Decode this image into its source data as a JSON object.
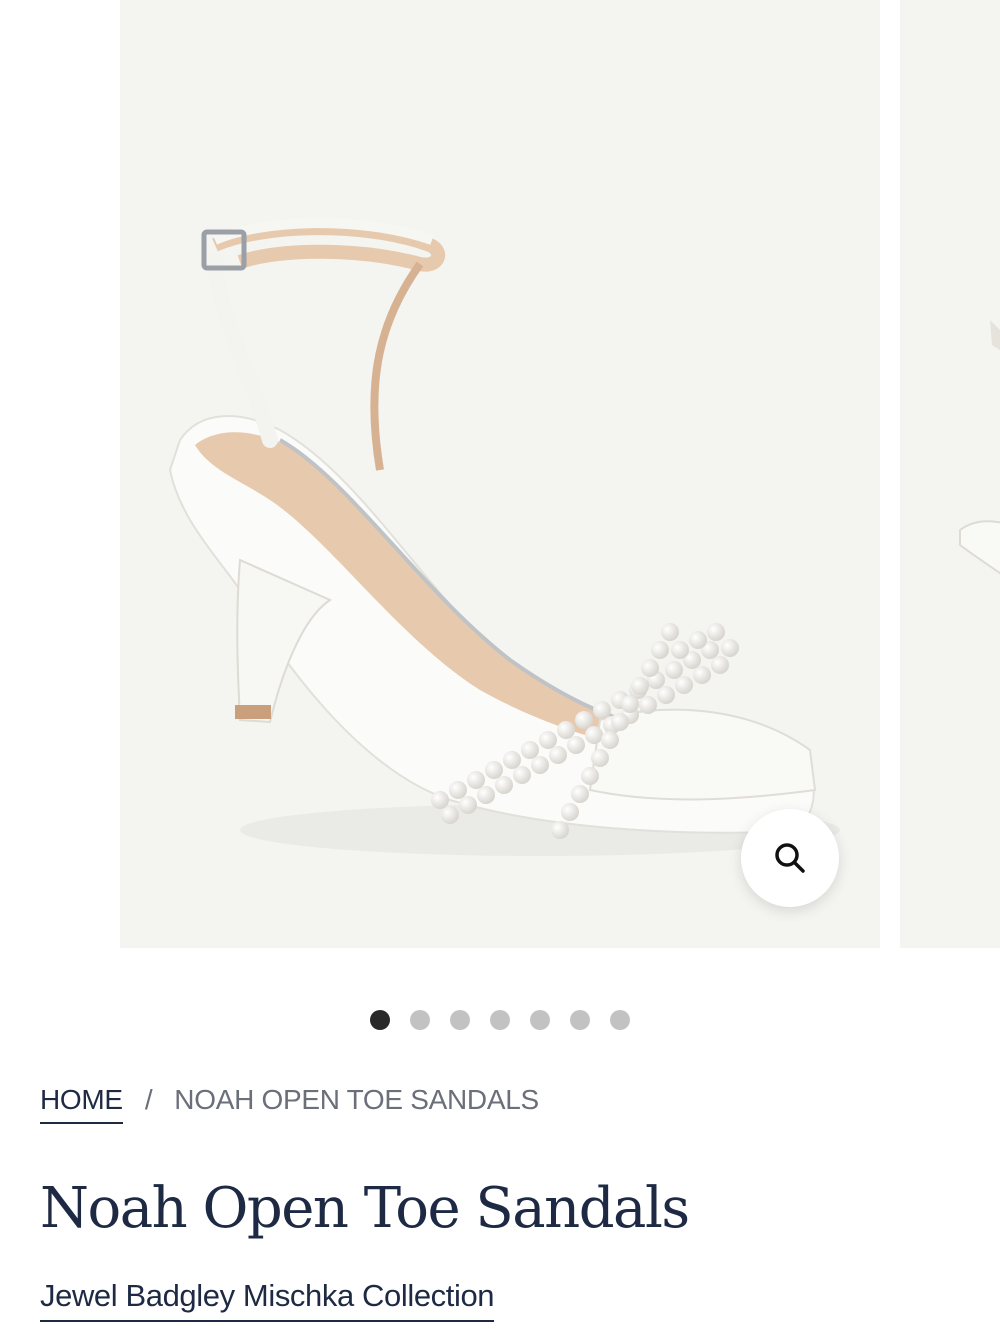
{
  "gallery": {
    "slide_count": 7,
    "active_index": 0,
    "background": "#f4f4f1",
    "zoom_icon": "search-icon"
  },
  "breadcrumb": {
    "home": "HOME",
    "separator": "/",
    "current": "NOAH OPEN TOE SANDALS"
  },
  "product": {
    "title": "Noah Open Toe Sandals",
    "collection": "Jewel Badgley Mischka Collection"
  },
  "colors": {
    "text_primary": "#1e2a44",
    "text_muted": "#6b6f7a",
    "dot_active": "#2a2a2a",
    "dot_inactive": "#c2c2c2"
  }
}
